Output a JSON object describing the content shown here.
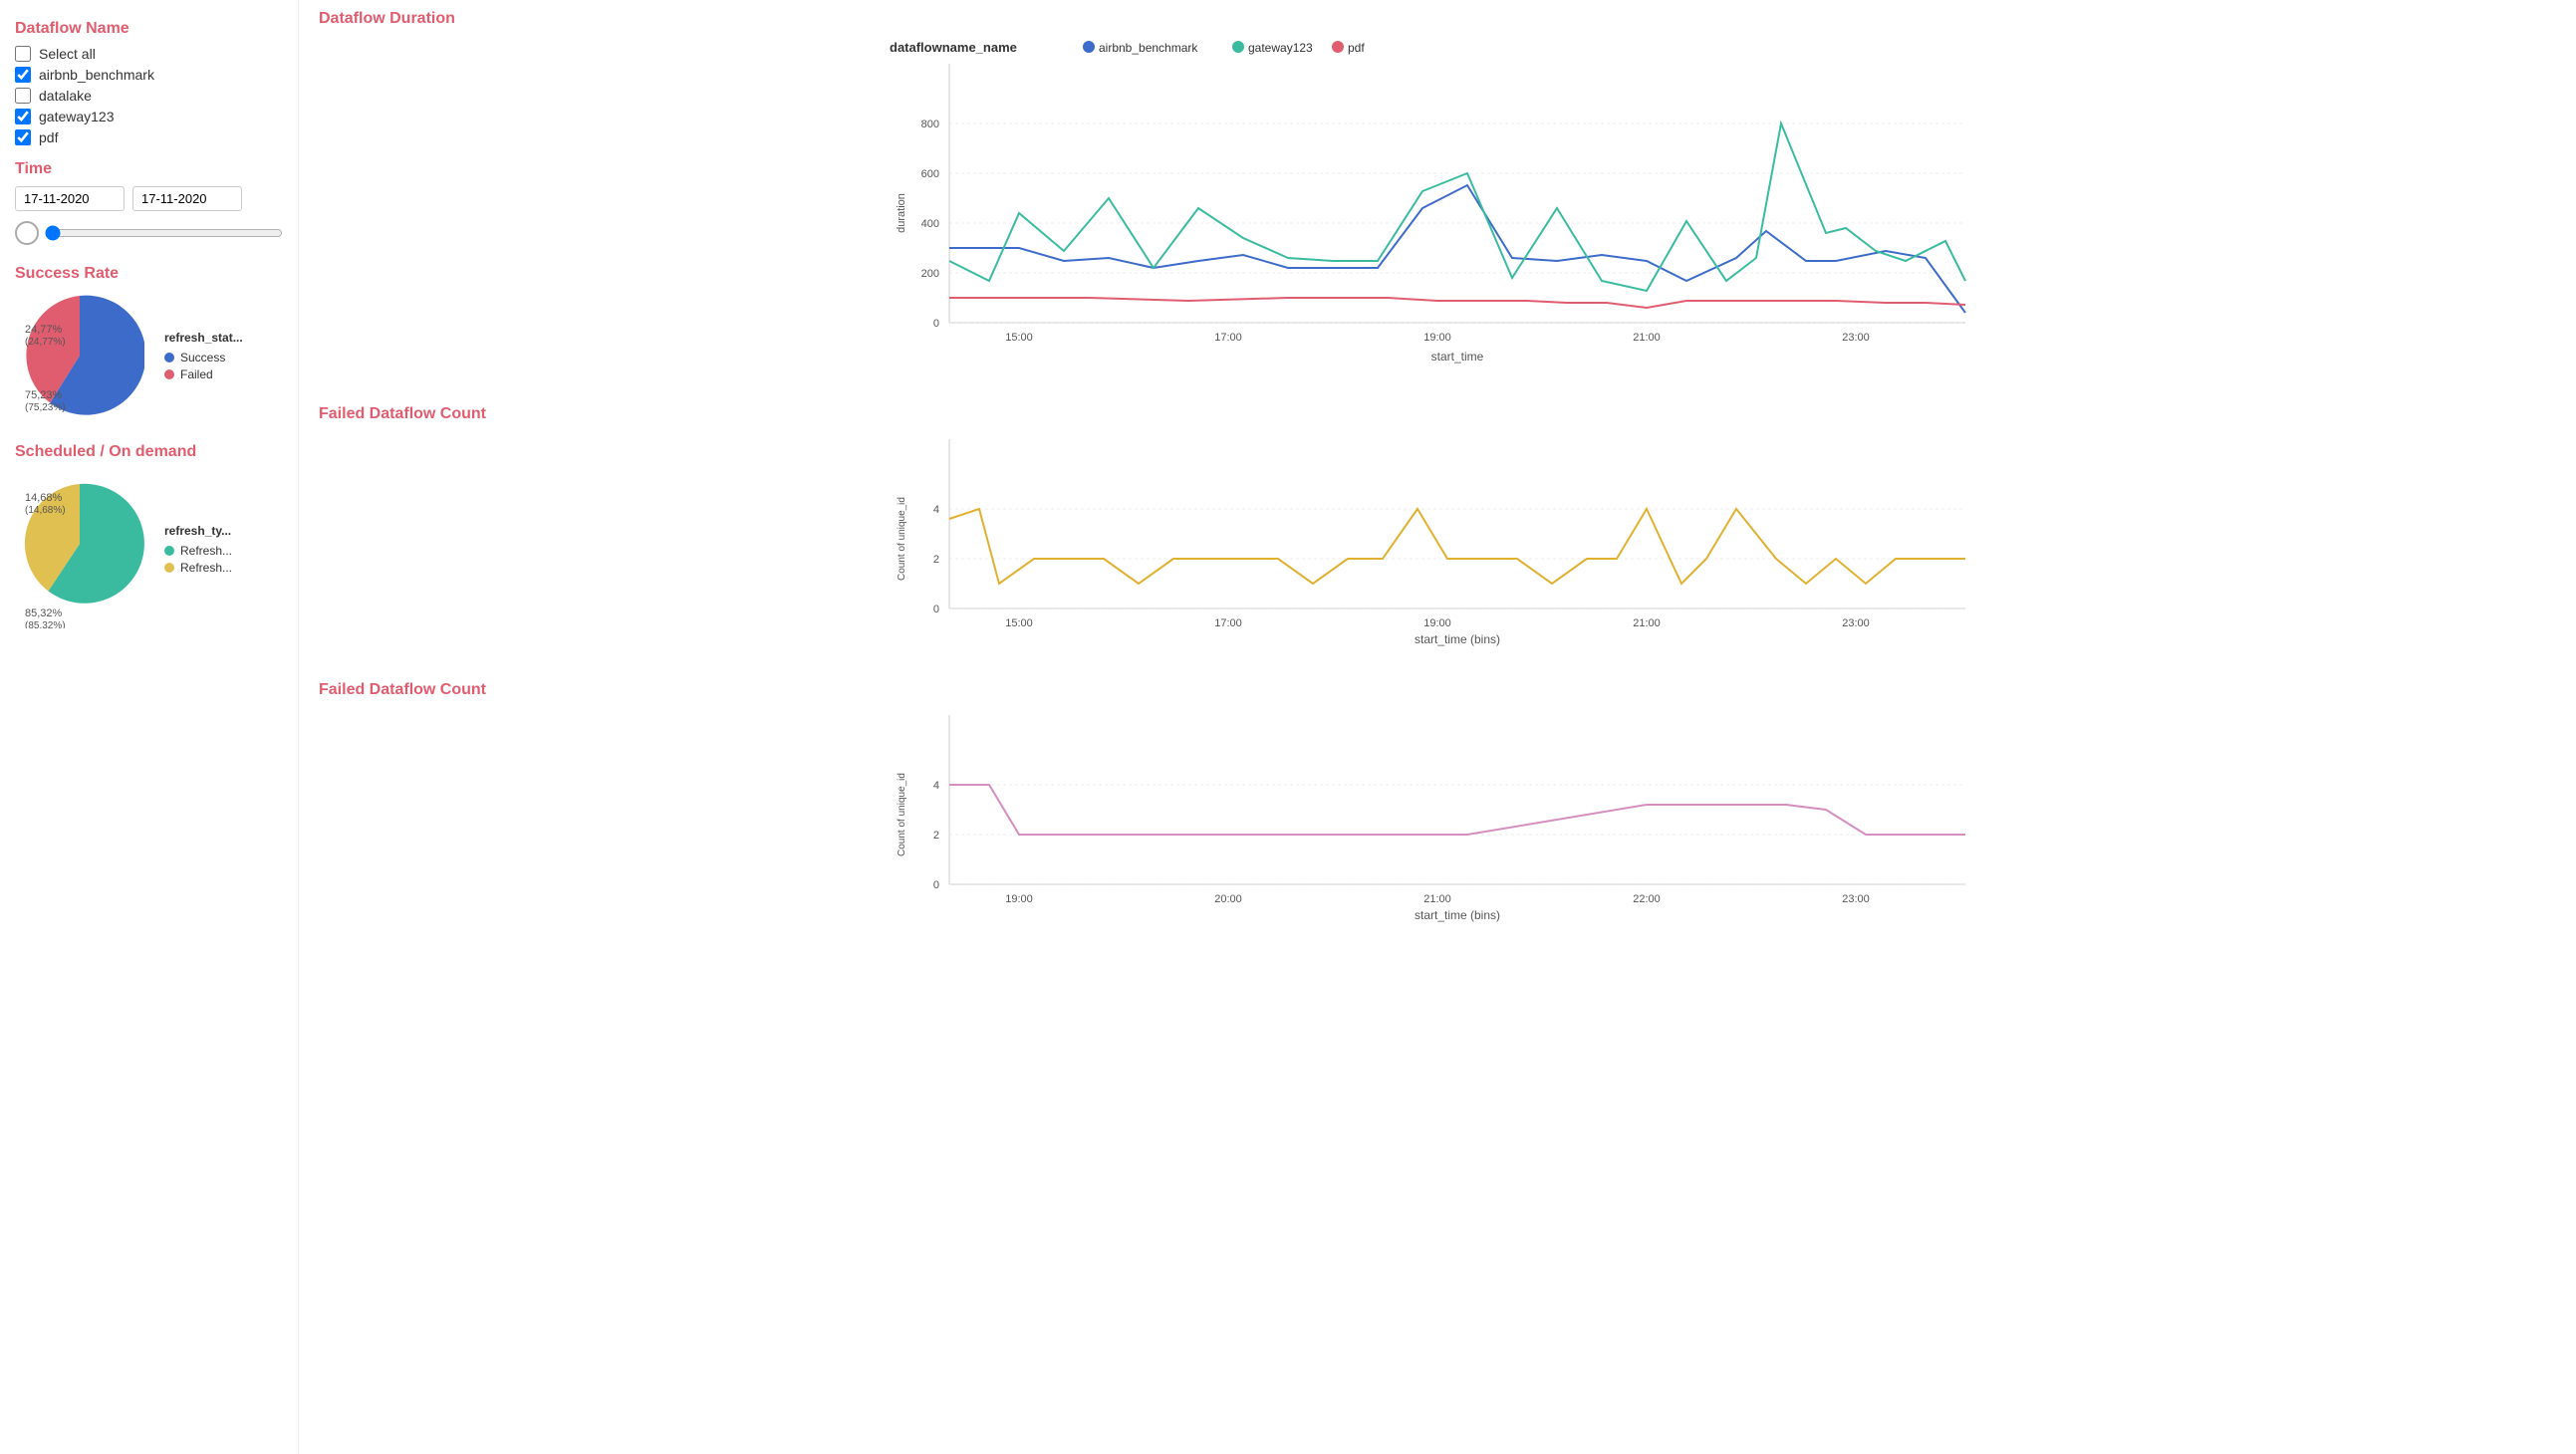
{
  "sidebar": {
    "dataflow_title": "Dataflow Name",
    "select_all_label": "Select all",
    "items": [
      {
        "id": "airbnb_benchmark",
        "label": "airbnb_benchmark",
        "checked": true
      },
      {
        "id": "datalake",
        "label": "datalake",
        "checked": false
      },
      {
        "id": "gateway123",
        "label": "gateway123",
        "checked": true
      },
      {
        "id": "pdf",
        "label": "pdf",
        "checked": true
      }
    ],
    "time_title": "Time",
    "date_start": "17-11-2020",
    "date_end": "17-11-2020"
  },
  "charts": {
    "dataflow_duration": {
      "title": "Dataflow Duration",
      "legend_label": "dataflowname_name",
      "series": [
        {
          "name": "airbnb_benchmark",
          "color": "#3c6bc9"
        },
        {
          "name": "gateway123",
          "color": "#3abba0"
        },
        {
          "name": "pdf",
          "color": "#e05d6f"
        }
      ],
      "x_label": "start_time",
      "y_label": "duration",
      "x_ticks": [
        "15:00",
        "17:00",
        "19:00",
        "21:00",
        "23:00"
      ],
      "y_ticks": [
        "0",
        "200",
        "400",
        "600",
        "800"
      ]
    },
    "failed_count_1": {
      "title": "Failed Dataflow Count",
      "color": "#e0b030",
      "x_label": "start_time (bins)",
      "y_label": "Count of unique_id",
      "x_ticks": [
        "15:00",
        "17:00",
        "19:00",
        "21:00",
        "23:00"
      ],
      "y_ticks": [
        "0",
        "2",
        "4"
      ]
    },
    "failed_count_2": {
      "title": "Failed Dataflow Count",
      "color": "#d48fbf",
      "x_label": "start_time (bins)",
      "y_label": "Count of unique_id",
      "x_ticks": [
        "19:00",
        "20:00",
        "21:00",
        "22:00",
        "23:00"
      ],
      "y_ticks": [
        "0",
        "2",
        "4"
      ]
    }
  },
  "success_rate": {
    "title": "Success Rate",
    "legend_title": "refresh_stat...",
    "slices": [
      {
        "label": "Success",
        "color": "#3c6bc9",
        "percent": 75.23,
        "display": "75,23%\n(75,23%)"
      },
      {
        "label": "Failed",
        "color": "#e05d6f",
        "percent": 24.77,
        "display": "24,77%\n(24,77%)"
      }
    ]
  },
  "scheduled": {
    "title": "Scheduled / On demand",
    "legend_title": "refresh_ty...",
    "slices": [
      {
        "label": "Refresh...",
        "color": "#3abba0",
        "percent": 85.32,
        "display": "85,32%\n(85,32%)"
      },
      {
        "label": "Refresh...",
        "color": "#e0c050",
        "percent": 14.68,
        "display": "14,68%\n(14,68%)"
      }
    ]
  }
}
